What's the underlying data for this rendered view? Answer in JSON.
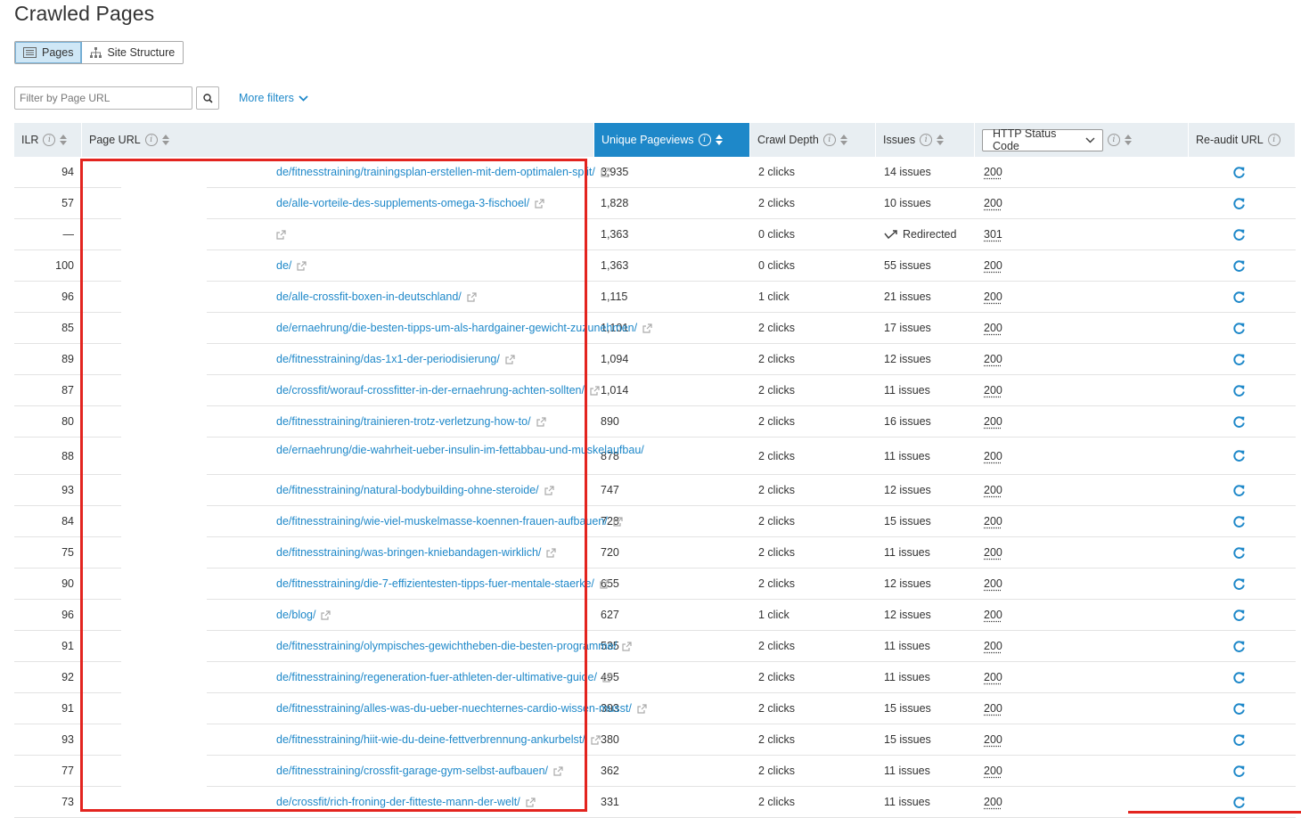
{
  "title": "Crawled Pages",
  "view_toggle": {
    "pages": "Pages",
    "site_structure": "Site Structure"
  },
  "filter": {
    "placeholder": "Filter by Page URL",
    "more_filters": "More filters"
  },
  "columns": {
    "ilr": "ILR",
    "page_url": "Page URL",
    "unique_pageviews": "Unique Pageviews",
    "crawl_depth": "Crawl Depth",
    "issues": "Issues",
    "http_status": "HTTP Status Code",
    "reaudit": "Re-audit URL"
  },
  "colors": {
    "accent": "#1e88c9",
    "highlight": "#e3241f",
    "header_bg": "#e8eef2"
  },
  "rows": [
    {
      "ilr": "94",
      "proto": "http://",
      "path": "de/fitnesstraining/trainingsplan-erstellen-mit-dem-optimalen-split/",
      "pageviews": "3,935",
      "depth": "2 clicks",
      "issues": "14 issues",
      "status": "200"
    },
    {
      "ilr": "57",
      "proto": "http://",
      "path": "de/alle-vorteile-des-supplements-omega-3-fischoel/",
      "pageviews": "1,828",
      "depth": "2 clicks",
      "issues": "10 issues",
      "status": "200"
    },
    {
      "ilr": "—",
      "proto": "http://",
      "path": "",
      "pageviews": "1,363",
      "depth": "0 clicks",
      "issues": "Redirected",
      "status": "301",
      "redirected": true
    },
    {
      "ilr": "100",
      "proto": "http://",
      "path": "de/",
      "pageviews": "1,363",
      "depth": "0 clicks",
      "issues": "55 issues",
      "status": "200"
    },
    {
      "ilr": "96",
      "proto": "http://",
      "path": "de/alle-crossfit-boxen-in-deutschland/",
      "pageviews": "1,115",
      "depth": "1 click",
      "issues": "21 issues",
      "status": "200"
    },
    {
      "ilr": "85",
      "proto": "http://",
      "path": "de/ernaehrung/die-besten-tipps-um-als-hardgainer-gewicht-zuzunehmen/",
      "pageviews": "1,101",
      "depth": "2 clicks",
      "issues": "17 issues",
      "status": "200"
    },
    {
      "ilr": "89",
      "proto": "http://",
      "path": "de/fitnesstraining/das-1x1-der-periodisierung/",
      "pageviews": "1,094",
      "depth": "2 clicks",
      "issues": "12 issues",
      "status": "200"
    },
    {
      "ilr": "87",
      "proto": "http://",
      "path": "de/crossfit/worauf-crossfitter-in-der-ernaehrung-achten-sollten/",
      "pageviews": "1,014",
      "depth": "2 clicks",
      "issues": "11 issues",
      "status": "200"
    },
    {
      "ilr": "80",
      "proto": "http://",
      "path": "de/fitnesstraining/trainieren-trotz-verletzung-how-to/",
      "pageviews": "890",
      "depth": "2 clicks",
      "issues": "16 issues",
      "status": "200"
    },
    {
      "ilr": "88",
      "proto": "http://",
      "path": "de/ernaehrung/die-wahrheit-ueber-insulin-im-fettabbau-und-muskelaufbau/",
      "pageviews": "878",
      "depth": "2 clicks",
      "issues": "11 issues",
      "status": "200",
      "tall": true
    },
    {
      "ilr": "93",
      "proto": "http://",
      "path": "de/fitnesstraining/natural-bodybuilding-ohne-steroide/",
      "pageviews": "747",
      "depth": "2 clicks",
      "issues": "12 issues",
      "status": "200"
    },
    {
      "ilr": "84",
      "proto": "http://",
      "path": "de/fitnesstraining/wie-viel-muskelmasse-koennen-frauen-aufbauen/",
      "pageviews": "728",
      "depth": "2 clicks",
      "issues": "15 issues",
      "status": "200"
    },
    {
      "ilr": "75",
      "proto": "http://",
      "path": "de/fitnesstraining/was-bringen-kniebandagen-wirklich/",
      "pageviews": "720",
      "depth": "2 clicks",
      "issues": "11 issues",
      "status": "200"
    },
    {
      "ilr": "90",
      "proto": "http://",
      "path": "de/fitnesstraining/die-7-effizientesten-tipps-fuer-mentale-staerke/",
      "pageviews": "655",
      "depth": "2 clicks",
      "issues": "12 issues",
      "status": "200"
    },
    {
      "ilr": "96",
      "proto": "http://",
      "path": "de/blog/",
      "pageviews": "627",
      "depth": "1 click",
      "issues": "12 issues",
      "status": "200"
    },
    {
      "ilr": "91",
      "proto": "http://",
      "path": "de/fitnesstraining/olympisches-gewichtheben-die-besten-programme/",
      "pageviews": "535",
      "depth": "2 clicks",
      "issues": "11 issues",
      "status": "200"
    },
    {
      "ilr": "92",
      "proto": "http://",
      "path": "de/fitnesstraining/regeneration-fuer-athleten-der-ultimative-guide/",
      "pageviews": "495",
      "depth": "2 clicks",
      "issues": "11 issues",
      "status": "200"
    },
    {
      "ilr": "91",
      "proto": "http://",
      "path": "de/fitnesstraining/alles-was-du-ueber-nuechternes-cardio-wissen-musst/",
      "pageviews": "393",
      "depth": "2 clicks",
      "issues": "15 issues",
      "status": "200"
    },
    {
      "ilr": "93",
      "proto": "http://",
      "path": "de/fitnesstraining/hiit-wie-du-deine-fettverbrennung-ankurbelst/",
      "pageviews": "380",
      "depth": "2 clicks",
      "issues": "15 issues",
      "status": "200"
    },
    {
      "ilr": "77",
      "proto": "http://",
      "path": "de/fitnesstraining/crossfit-garage-gym-selbst-aufbauen/",
      "pageviews": "362",
      "depth": "2 clicks",
      "issues": "11 issues",
      "status": "200"
    },
    {
      "ilr": "73",
      "proto": "http://",
      "path": "de/crossfit/rich-froning-der-fitteste-mann-der-welt/",
      "pageviews": "331",
      "depth": "2 clicks",
      "issues": "11 issues",
      "status": "200"
    }
  ]
}
